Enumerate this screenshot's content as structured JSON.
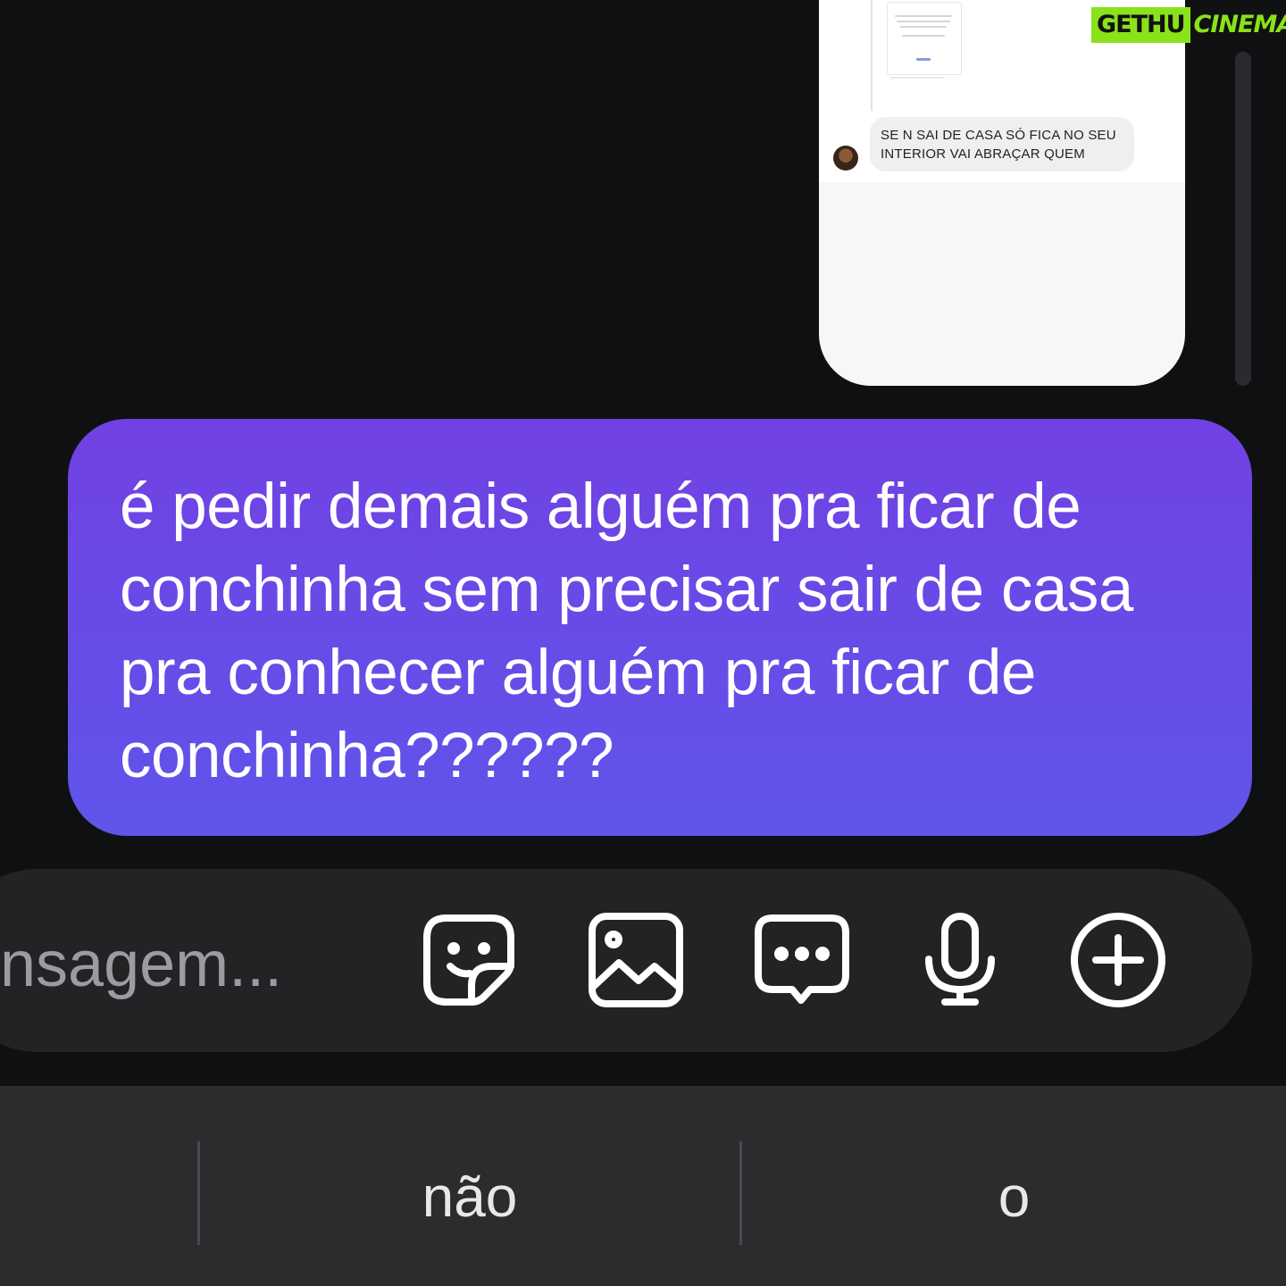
{
  "shared_preview": {
    "reply_text": "SE N SAI DE CASA SÓ FICA NO SEU INTERIOR VAI ABRAÇAR QUEM"
  },
  "watermark": {
    "left": "GETHU",
    "right": "CINEMA",
    "colors": {
      "green": "#8ae21b",
      "dark": "#111111"
    }
  },
  "message": {
    "text": "é pedir demais alguém pra ficar de conchinha sem precisar sair de casa pra conhecer alguém pra ficar de conchinha??????",
    "bubble_colors": [
      "#7141e3",
      "#5f55ea"
    ]
  },
  "composer": {
    "placeholder_visible": "nsagem...",
    "icons": [
      "sticker-icon",
      "image-icon",
      "chat-more-icon",
      "microphone-icon",
      "plus-circle-icon"
    ]
  },
  "keyboard": {
    "suggestions": [
      "",
      "não",
      "o"
    ]
  },
  "theme": {
    "background": "#0f1012",
    "composer_bg": "#222325",
    "keyboard_bg": "#2b2c2e"
  }
}
